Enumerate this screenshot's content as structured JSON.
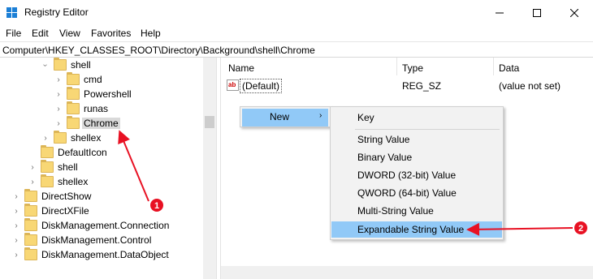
{
  "window": {
    "title": "Registry Editor"
  },
  "menu": [
    "File",
    "Edit",
    "View",
    "Favorites",
    "Help"
  ],
  "address": "Computer\\HKEY_CLASSES_ROOT\\Directory\\Background\\shell\\Chrome",
  "tree": {
    "items": [
      {
        "label": "shell",
        "expanded": true
      },
      {
        "label": "cmd"
      },
      {
        "label": "Powershell"
      },
      {
        "label": "runas"
      },
      {
        "label": "Chrome",
        "selected": true
      },
      {
        "label": "shellex"
      },
      {
        "label": "DefaultIcon"
      },
      {
        "label": "shell"
      },
      {
        "label": "shellex"
      },
      {
        "label": "DirectShow"
      },
      {
        "label": "DirectXFile"
      },
      {
        "label": "DiskManagement.Connection"
      },
      {
        "label": "DiskManagement.Control"
      },
      {
        "label": "DiskManagement.DataObject"
      }
    ]
  },
  "list": {
    "columns": {
      "name": "Name",
      "type": "Type",
      "data": "Data"
    },
    "rows": [
      {
        "icon": "ab",
        "name": "(Default)",
        "type": "REG_SZ",
        "data": "(value not set)"
      }
    ]
  },
  "context_menu": {
    "new_label": "New",
    "arrow": "›"
  },
  "submenu": {
    "items": [
      {
        "label": "Key"
      },
      {
        "label": "String Value"
      },
      {
        "label": "Binary Value"
      },
      {
        "label": "DWORD (32-bit) Value"
      },
      {
        "label": "QWORD (64-bit) Value"
      },
      {
        "label": "Multi-String Value"
      },
      {
        "label": "Expandable String Value",
        "highlighted": true
      }
    ]
  },
  "annotations": [
    {
      "number": "1",
      "color": "#e81123"
    },
    {
      "number": "2",
      "color": "#e81123"
    }
  ],
  "colors": {
    "highlight": "#91c9f7",
    "folder": "#f8d775",
    "annotation": "#e81123"
  }
}
